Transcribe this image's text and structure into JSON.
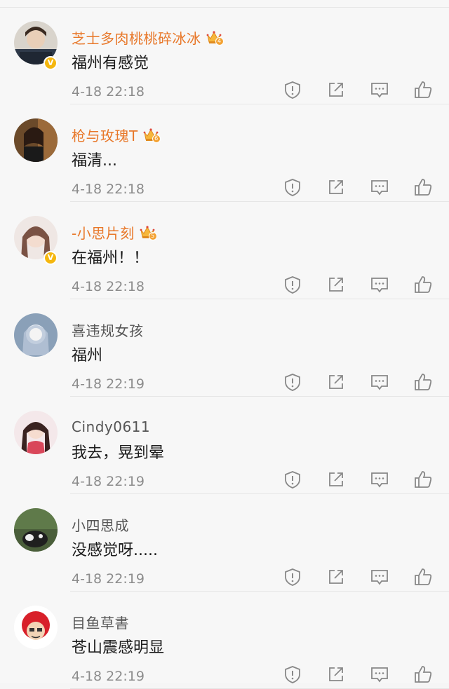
{
  "comments": [
    {
      "name": "芝士多肉桃桃碎冰冰",
      "name_style": "vip",
      "crown_level": "4",
      "verified": true,
      "text": "福州有感觉",
      "time": "4-18 22:18",
      "avatar_theme": "a1"
    },
    {
      "name": "枪与玫瑰T",
      "name_style": "vip",
      "crown_level": "6",
      "verified": false,
      "text": "福清...",
      "time": "4-18 22:18",
      "avatar_theme": "a2"
    },
    {
      "name": "-小思片刻",
      "name_style": "vip",
      "crown_level": "5",
      "verified": true,
      "text": "在福州！！",
      "time": "4-18 22:18",
      "avatar_theme": "a3"
    },
    {
      "name": "喜违规女孩",
      "name_style": "normal",
      "crown_level": "",
      "verified": false,
      "text": "福州",
      "time": "4-18 22:19",
      "avatar_theme": "a4"
    },
    {
      "name": "Cindy0611",
      "name_style": "normal",
      "crown_level": "",
      "verified": false,
      "text": "我去，晃到晕",
      "time": "4-18 22:19",
      "avatar_theme": "a5"
    },
    {
      "name": "小四思成",
      "name_style": "normal",
      "crown_level": "",
      "verified": false,
      "text": "没感觉呀.....",
      "time": "4-18 22:19",
      "avatar_theme": "a6"
    },
    {
      "name": "目鱼草書",
      "name_style": "normal",
      "crown_level": "",
      "verified": false,
      "text": "苍山震感明显",
      "time": "4-18 22:19",
      "avatar_theme": "a7"
    }
  ],
  "action_icons": [
    "report-icon",
    "share-icon",
    "reply-icon",
    "like-icon"
  ],
  "verified_mark": "V",
  "colors": {
    "vip_name": "#e8782a",
    "normal_name": "#555555",
    "verified_badge": "#f5b70f",
    "icon_gray": "#888888"
  }
}
